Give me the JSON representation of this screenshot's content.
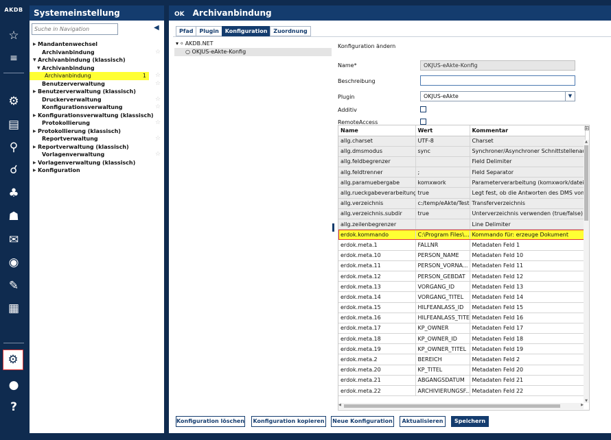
{
  "rail": {
    "logo": "AKDB",
    "icons": [
      "star-icon",
      "list-icon",
      "user-settings-icon",
      "document-settings-icon",
      "person-search-icon",
      "search-user-icon",
      "group-icon",
      "people-icon",
      "mail-icon",
      "target-icon",
      "user-edit-icon",
      "document-edit-icon",
      "gears-icon",
      "user-icon",
      "help-icon"
    ],
    "help_glyph": "?"
  },
  "nav": {
    "title": "Systemeinstellung",
    "search_placeholder": "Suche in Navigation",
    "items": [
      {
        "label": "Mandantenwechsel",
        "level": 0,
        "tri": "right"
      },
      {
        "label": "Archivanbindung",
        "level": 1,
        "star": true
      },
      {
        "label": "Archivanbindung (klassisch)",
        "level": 0,
        "tri": "down"
      },
      {
        "label": "Archivanbindung",
        "level": 1,
        "tri": "down"
      },
      {
        "label": "Archivanbindung",
        "level": 2,
        "selected": true,
        "count": "1",
        "star": true
      },
      {
        "label": "Benutzerverwaltung",
        "level": 1,
        "star": true
      },
      {
        "label": "Benutzerverwaltung (klassisch)",
        "level": 0,
        "tri": "right"
      },
      {
        "label": "Druckerverwaltung",
        "level": 1,
        "star": true
      },
      {
        "label": "Konfigurationsverwaltung",
        "level": 1,
        "star": true
      },
      {
        "label": "Konfigurationsverwaltung (klassisch)",
        "level": 0,
        "tri": "right"
      },
      {
        "label": "Protokollierung",
        "level": 1,
        "star": true
      },
      {
        "label": "Protokollierung (klassisch)",
        "level": 0,
        "tri": "right"
      },
      {
        "label": "Reportverwaltung",
        "level": 1,
        "star": true
      },
      {
        "label": "Reportverwaltung (klassisch)",
        "level": 0,
        "tri": "right"
      },
      {
        "label": "Vorlagenverwaltung",
        "level": 1,
        "star": true
      },
      {
        "label": "Vorlagenverwaltung (klassisch)",
        "level": 0,
        "tri": "right"
      },
      {
        "label": "Konfiguration",
        "level": 0,
        "tri": "right"
      }
    ]
  },
  "main": {
    "ok_label": "OK",
    "title": "Archivanbindung",
    "tabs": [
      "Pfad",
      "Plugin",
      "Konfiguration",
      "Zuordnung"
    ],
    "active_tab": "Konfiguration",
    "tree": {
      "root": "AKDB.NET",
      "child": "OKJUS-eAkte-Konfig"
    },
    "form": {
      "heading": "Konfiguration ändern",
      "name_label": "Name*",
      "name_value": "OKJUS-eAkte-Konfig",
      "beschreibung_label": "Beschreibung",
      "beschreibung_value": "",
      "plugin_label": "Plugin",
      "plugin_value": "OKJUS-eAkte",
      "additiv_label": "Additiv",
      "remote_label": "RemoteAccess"
    },
    "grid": {
      "columns": [
        "Name",
        "Wert",
        "Kommentar"
      ],
      "rows": [
        [
          "allg.charset",
          "UTF-8",
          "Charset"
        ],
        [
          "allg.dmsmodus",
          "sync",
          "Synchroner/Asynchroner Schnittstellenaufruf"
        ],
        [
          "allg.feldbegrenzer",
          "",
          "Field Delimiter"
        ],
        [
          "allg.feldtrenner",
          ";",
          "Field Separator"
        ],
        [
          "allg.paramuebergabe",
          "komxwork",
          "Parameterverarbeitung (komxwork/datei/para"
        ],
        [
          "allg.rueckgabeverarbeitung",
          "true",
          "Legt fest, ob die Antworten des DMS von O"
        ],
        [
          "allg.verzeichnis",
          "c:/temp/eAkte/Test",
          "Transferverzeichnis"
        ],
        [
          "allg.verzeichnis.subdir",
          "true",
          "Unterverzeichnis verwenden (true/false)"
        ],
        [
          "allg.zeilenbegrenzer",
          "",
          "Line Delimiter"
        ],
        [
          "erdok.kommando",
          "C:\\Program Files\\...",
          "Kommando für: erzeuge Dokument"
        ],
        [
          "erdok.meta.1",
          "FALLNR",
          "Metadaten Feld 1"
        ],
        [
          "erdok.meta.10",
          "PERSON_NAME",
          "Metadaten Feld 10"
        ],
        [
          "erdok.meta.11",
          "PERSON_VORNA...",
          "Metadaten Feld 11"
        ],
        [
          "erdok.meta.12",
          "PERSON_GEBDAT",
          "Metadaten Feld 12"
        ],
        [
          "erdok.meta.13",
          "VORGANG_ID",
          "Metadaten Feld 13"
        ],
        [
          "erdok.meta.14",
          "VORGANG_TITEL",
          "Metadaten Feld 14"
        ],
        [
          "erdok.meta.15",
          "HILFEANLASS_ID",
          "Metadaten Feld 15"
        ],
        [
          "erdok.meta.16",
          "HILFEANLASS_TITEL",
          "Metadaten Feld 16"
        ],
        [
          "erdok.meta.17",
          "KP_OWNER",
          "Metadaten Feld 17"
        ],
        [
          "erdok.meta.18",
          "KP_OWNER_ID",
          "Metadaten Feld 18"
        ],
        [
          "erdok.meta.19",
          "KP_OWNER_TITEL",
          "Metadaten Feld 19"
        ],
        [
          "erdok.meta.2",
          "BEREICH",
          "Metadaten Feld 2"
        ],
        [
          "erdok.meta.20",
          "KP_TITEL",
          "Metadaten Feld 20"
        ],
        [
          "erdok.meta.21",
          "ABGANGSDATUM",
          "Metadaten Feld 21"
        ],
        [
          "erdok.meta.22",
          "ARCHIVIERUNGSF...",
          "Metadaten Feld 22"
        ]
      ],
      "highlighted_row": 9
    },
    "buttons": [
      {
        "label": "Konfiguration löschen",
        "primary": false
      },
      {
        "label": "Konfiguration kopieren",
        "primary": false
      },
      {
        "label": "Neue Konfiguration",
        "primary": false
      },
      {
        "label": "Aktualisieren",
        "primary": false
      },
      {
        "label": "Speichern",
        "primary": true
      }
    ]
  }
}
